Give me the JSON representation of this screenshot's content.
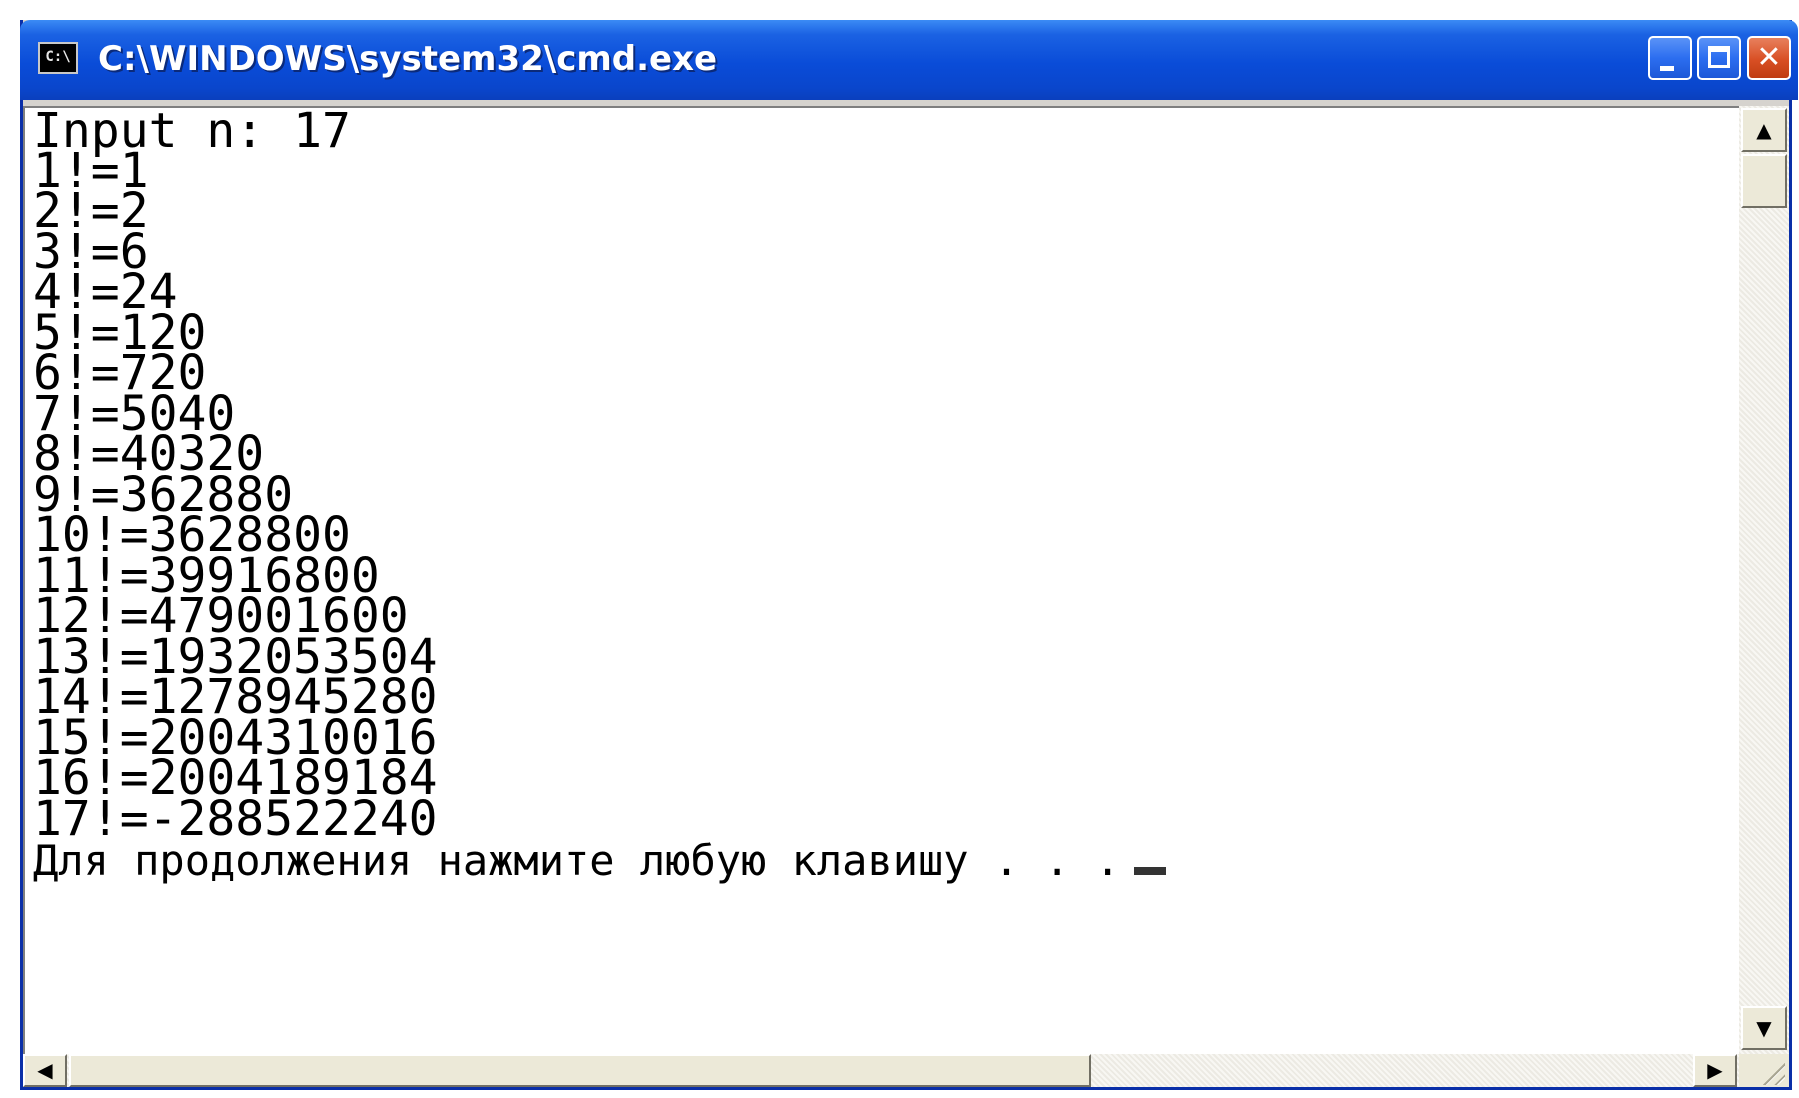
{
  "window": {
    "title": "C:\\WINDOWS\\system32\\cmd.exe",
    "icon": "cmd-icon",
    "icon_text": "C:\\"
  },
  "titlebar_buttons": {
    "minimize": "minimize-icon",
    "maximize": "maximize-icon",
    "close": "close-icon",
    "close_glyph": "✕"
  },
  "console": {
    "lines": [
      "Input n: 17",
      "1!=1",
      "2!=2",
      "3!=6",
      "4!=24",
      "5!=120",
      "6!=720",
      "7!=5040",
      "8!=40320",
      "9!=362880",
      "10!=3628800",
      "11!=39916800",
      "12!=479001600",
      "13!=1932053504",
      "14!=1278945280",
      "15!=2004310016",
      "16!=2004189184",
      "17!=-288522240",
      "Для продолжения нажмите любую клавишу . . ."
    ]
  },
  "scrollbars": {
    "up_arrow": "▲",
    "down_arrow": "▼",
    "left_arrow": "◀",
    "right_arrow": "▶"
  },
  "colors": {
    "titlebar": "#0a4cd8",
    "close_button": "#d84f24",
    "console_bg": "#ffffff",
    "console_text": "#000000"
  }
}
